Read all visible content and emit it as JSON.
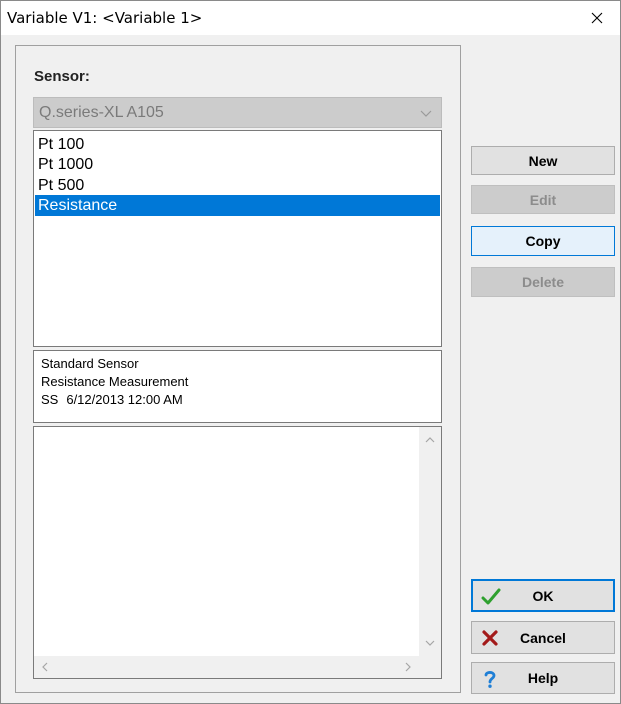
{
  "window": {
    "title": "Variable V1: <Variable 1>"
  },
  "icons": {
    "close": "close-icon",
    "dropdown": "chevron-down-icon",
    "ok": "checkmark-icon",
    "cancel": "x-mark-icon",
    "help": "question-mark-icon"
  },
  "colors": {
    "selection": "#0078d7",
    "ok_check": "#2ea02e",
    "cancel_x": "#a31a1a",
    "help_q": "#1f7fd6"
  },
  "sensor": {
    "label": "Sensor:",
    "combo_value": "Q.series-XL A105",
    "list": [
      {
        "label": "Pt 100",
        "selected": false
      },
      {
        "label": "Pt 1000",
        "selected": false
      },
      {
        "label": "Pt 500",
        "selected": false
      },
      {
        "label": "Resistance",
        "selected": true
      }
    ]
  },
  "info": {
    "line1": "Standard Sensor",
    "line2": "Resistance Measurement",
    "author": "SS",
    "date": "6/12/2013 12:00 AM"
  },
  "buttons": {
    "new": "New",
    "edit": "Edit",
    "copy": "Copy",
    "delete": "Delete",
    "ok": "OK",
    "cancel": "Cancel",
    "help": "Help"
  }
}
